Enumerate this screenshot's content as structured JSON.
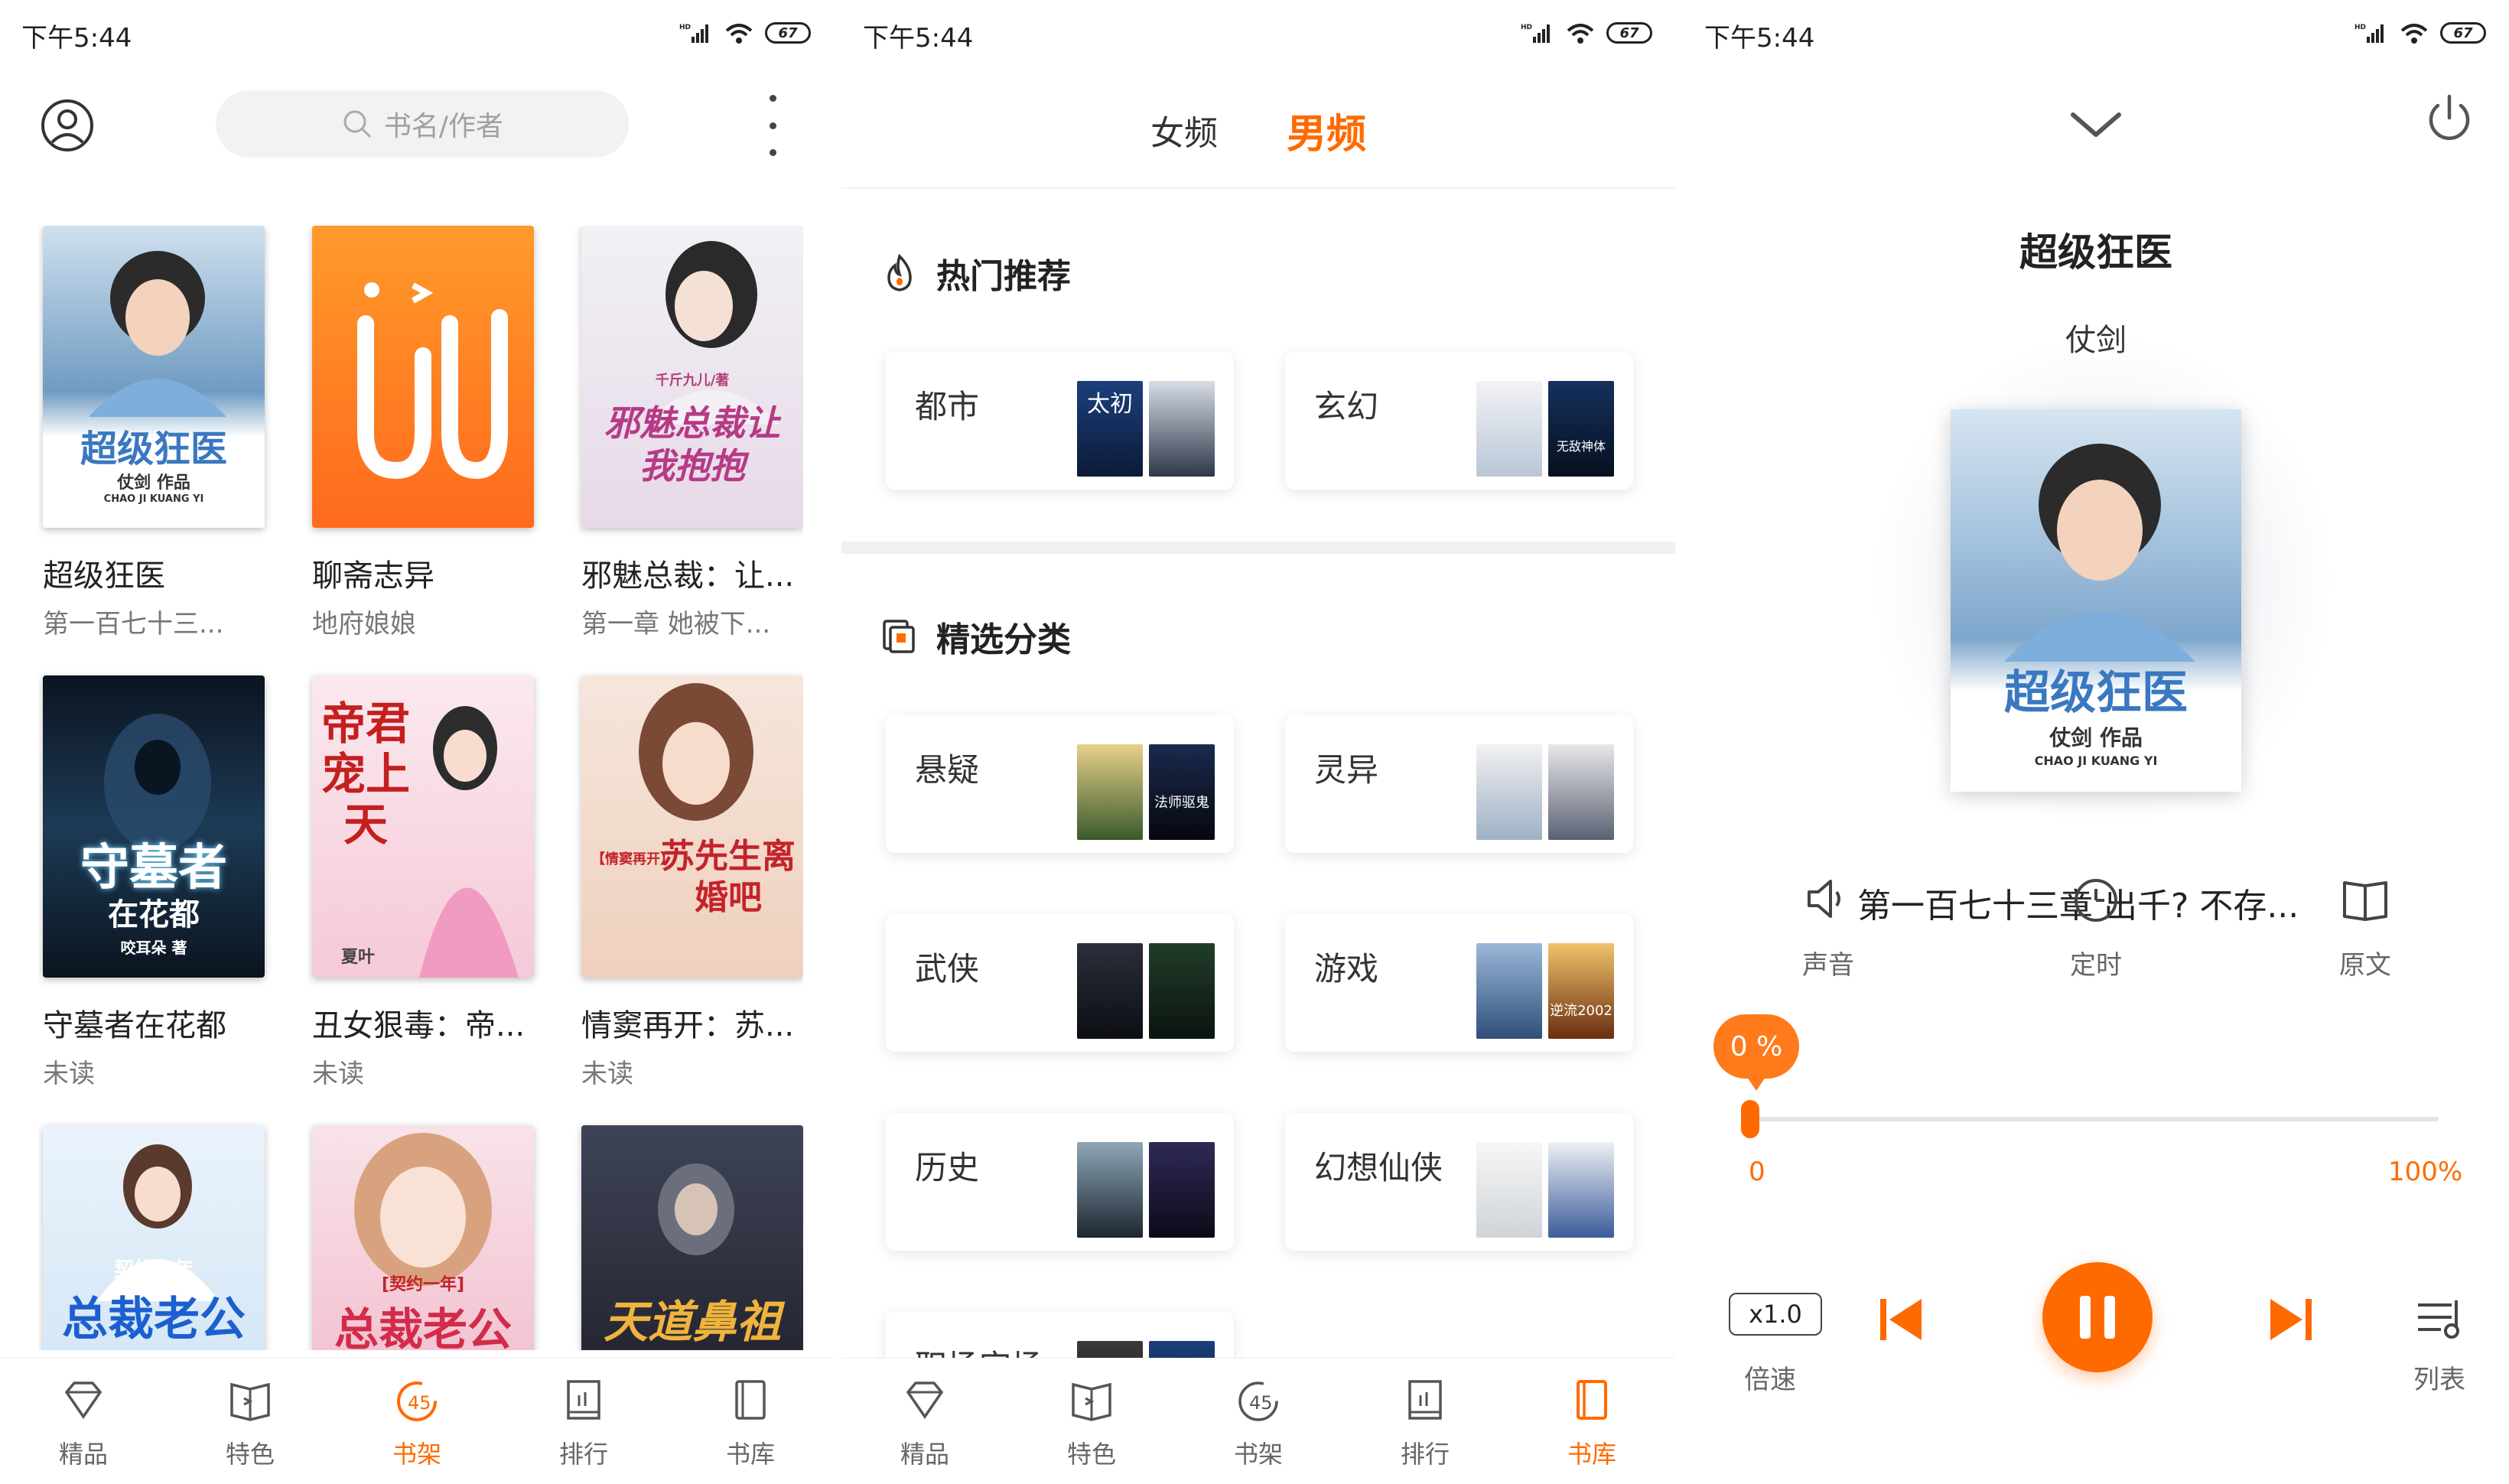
{
  "status": {
    "time": "下午5:44",
    "battery": "67"
  },
  "shelf": {
    "search_placeholder": "书名/作者",
    "books": [
      {
        "title": "超级狂医",
        "sub": "第一百七十三...",
        "cover_text": "超级狂医",
        "cover_author": "仗剑 作品",
        "cover_pinyin": "CHAO JI KUANG YI"
      },
      {
        "title": "聊斋志异",
        "sub": "地府娘娘"
      },
      {
        "title": "邪魅总裁：让...",
        "sub": "第一章 她被下...",
        "cover_text": "邪魅总裁让我抱抱",
        "cover_author": "千斤九儿/著"
      },
      {
        "title": "守墓者在花都",
        "sub": "未读",
        "cover_text": "守墓者",
        "cover_text2": "在花都",
        "cover_author": "咬耳朵 著"
      },
      {
        "title": "丑女狠毒：帝...",
        "sub": "未读",
        "cover_text": "帝君宠上天",
        "cover_author": "夏叶"
      },
      {
        "title": "情窦再开：苏...",
        "sub": "未读",
        "cover_text": "苏先生离婚吧",
        "cover_tag": "【情窦再开】"
      },
      {
        "title": "",
        "sub": "",
        "cover_text": "总裁老公",
        "cover_tag": "契约一年"
      },
      {
        "title": "",
        "sub": "",
        "cover_text": "总裁老公",
        "cover_tag": "[契约一年]"
      },
      {
        "title": "",
        "sub": "",
        "cover_text": "天道鼻祖"
      }
    ]
  },
  "tabs": [
    {
      "label": "精品",
      "icon": "diamond-icon"
    },
    {
      "label": "特色",
      "icon": "feature-book-icon"
    },
    {
      "label": "书架",
      "icon": "shelf-icon"
    },
    {
      "label": "排行",
      "icon": "rank-icon"
    },
    {
      "label": "书库",
      "icon": "library-icon"
    }
  ],
  "library": {
    "tab_female": "女频",
    "tab_male": "男频",
    "hot_title": "热门推荐",
    "category_title": "精选分类",
    "hot": [
      {
        "name": "都市",
        "mini1": "太初"
      },
      {
        "name": "玄幻",
        "mini2": "无敌神体"
      }
    ],
    "categories": [
      {
        "name": "悬疑",
        "mini2": "法师驱鬼"
      },
      {
        "name": "灵异"
      },
      {
        "name": "武侠"
      },
      {
        "name": "游戏",
        "mini2": "逆流2002"
      },
      {
        "name": "历史"
      },
      {
        "name": "幻想仙侠"
      },
      {
        "name": "职场宫场"
      }
    ]
  },
  "player": {
    "title": "超级狂医",
    "author": "仗剑",
    "cover_text": "超级狂医",
    "cover_author": "仗剑 作品",
    "cover_pinyin": "CHAO JI KUANG YI",
    "chapter": "第一百七十三章 出千? 不存...",
    "sound_label": "声音",
    "timer_label": "定时",
    "original_label": "原文",
    "progress_badge": "0 %",
    "progress_value": 0,
    "progress_min": "0",
    "progress_max": "100%",
    "speed": "x1.0",
    "speed_label": "倍速",
    "list_label": "列表"
  },
  "colors": {
    "accent": "#ff6a00"
  }
}
